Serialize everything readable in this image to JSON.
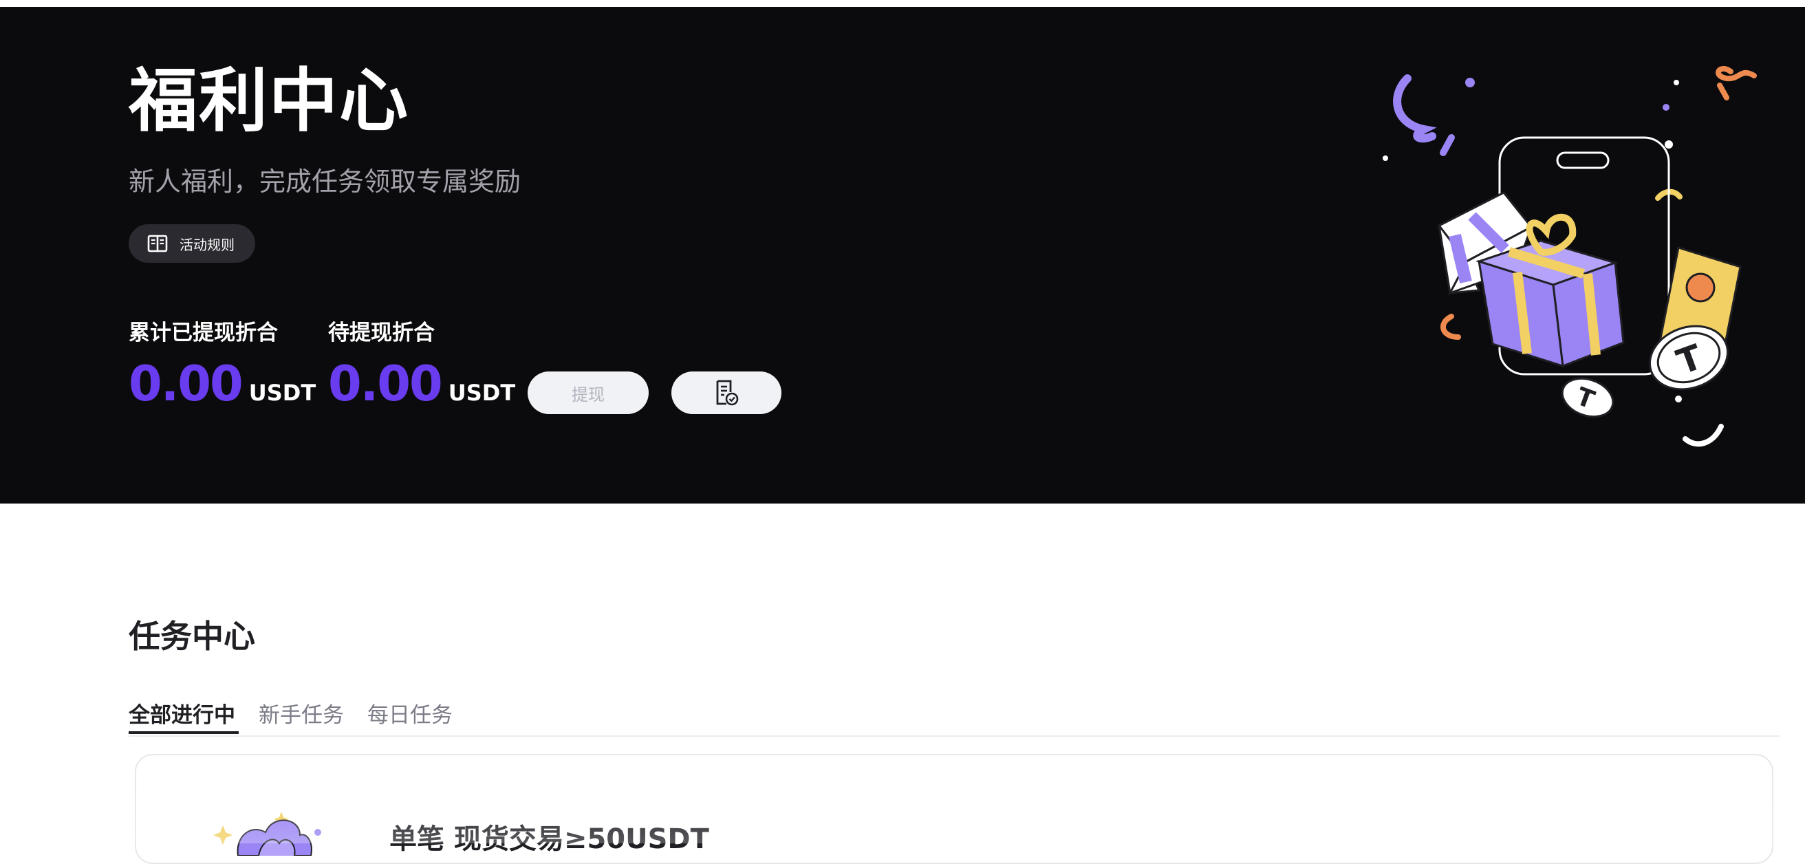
{
  "hero": {
    "title": "福利中心",
    "subtitle": "新人福利，完成任务领取专属奖励",
    "rules_label": "活动规则",
    "rules_icon": "book-icon",
    "withdrawn": {
      "caption": "累计已提现折合",
      "value": "0.00",
      "unit": "USDT"
    },
    "pending": {
      "caption": "待提现折合",
      "value": "0.00",
      "unit": "USDT"
    },
    "withdraw_label": "提现",
    "record_icon": "record-check-icon",
    "illustration": "gift-boxes-phone-coins-illustration"
  },
  "tasks": {
    "section_title": "任务中心",
    "tabs": [
      {
        "label": "全部进行中",
        "active": true
      },
      {
        "label": "新手任务",
        "active": false
      },
      {
        "label": "每日任务",
        "active": false
      }
    ],
    "cards": [
      {
        "title": "单笔 现货交易≥50USDT",
        "icon": "gift-icon"
      }
    ]
  },
  "colors": {
    "accent": "#6a3cf0",
    "hero_bg": "#0b0b0d",
    "gift_purple": "#9b85f5",
    "gold": "#f2d063",
    "orange": "#ef8a4f"
  }
}
